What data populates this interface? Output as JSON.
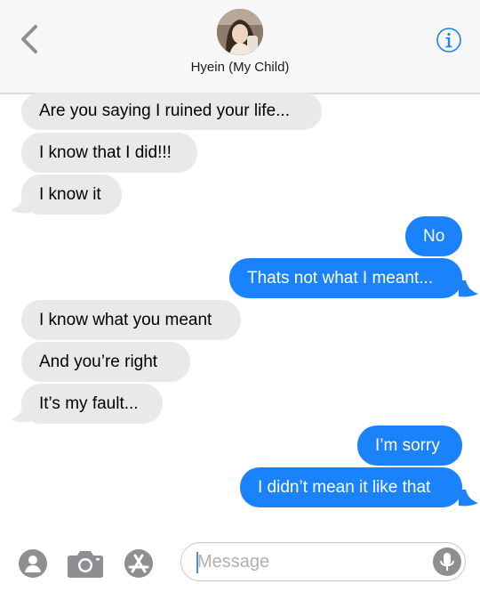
{
  "header": {
    "contact_name": "Hyein (My Child)",
    "back_icon": "chevron-left-icon",
    "info_icon": "info-icon",
    "accent_color": "#1a82fb"
  },
  "messages": [
    {
      "direction": "incoming",
      "text": "Are you saying I ruined your life..."
    },
    {
      "direction": "incoming",
      "text": "I know that I did!!!"
    },
    {
      "direction": "incoming",
      "text": "I know it"
    },
    {
      "direction": "outgoing",
      "text": "No"
    },
    {
      "direction": "outgoing",
      "text": "Thats not what I meant..."
    },
    {
      "direction": "incoming",
      "text": "I know what you meant"
    },
    {
      "direction": "incoming",
      "text": "And you’re right"
    },
    {
      "direction": "incoming",
      "text": "It’s my fault..."
    },
    {
      "direction": "outgoing",
      "text": "I’m sorry"
    },
    {
      "direction": "outgoing",
      "text": "I didn’t mean it like that"
    }
  ],
  "composer": {
    "placeholder": "Message",
    "icons": [
      "apps-icon",
      "camera-icon",
      "app-store-icon",
      "microphone-icon"
    ]
  },
  "colors": {
    "incoming_bubble": "#e9e9eb",
    "outgoing_bubble": "#1a82fb"
  }
}
